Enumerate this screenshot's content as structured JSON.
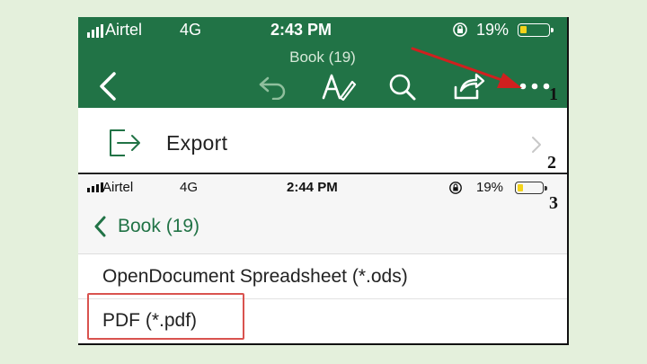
{
  "top_status": {
    "carrier": "Airtel",
    "network": "4G",
    "time": "2:43 PM",
    "battery": "19%"
  },
  "header": {
    "title": "Book (19)"
  },
  "annotations": {
    "step1": "1",
    "step2": "2",
    "step3": "3"
  },
  "export_row": {
    "label": "Export"
  },
  "bottom_status": {
    "carrier": "Airtel",
    "network": "4G",
    "time": "2:44 PM",
    "battery": "19%"
  },
  "nav": {
    "back_label": "Book (19)"
  },
  "options": [
    {
      "label": "OpenDocument Spreadsheet (*.ods)"
    },
    {
      "label": "PDF (*.pdf)"
    }
  ],
  "colors": {
    "excel_green": "#217346",
    "highlight_red": "#d9534f",
    "arrow_red": "#d0201f",
    "battery_yellow": "#f4d31a"
  },
  "icons": [
    "back-chevron-icon",
    "undo-icon",
    "draw-pen-icon",
    "search-icon",
    "share-icon",
    "more-icon",
    "export-icon",
    "chevron-right-icon",
    "lock-rotation-icon"
  ]
}
